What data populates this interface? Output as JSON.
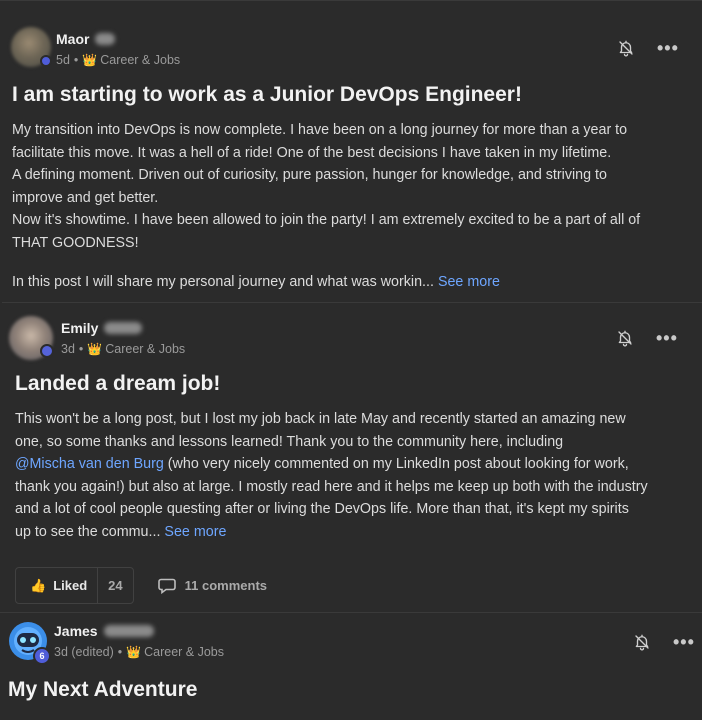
{
  "posts": [
    {
      "author": "Maor",
      "time": "5d",
      "category": "Career & Jobs",
      "title": "I am starting to work as a Junior DevOps Engineer!",
      "body_lines": [
        "My transition into DevOps is now complete. I have been on a long journey for more than a year to",
        "facilitate this move. It was a hell of a ride! One of the best decisions I have taken in my lifetime.",
        "A defining moment. Driven out of curiosity, pure passion, hunger for knowledge, and striving to",
        "improve and get better.",
        "Now it's showtime. I have been allowed to join the party! I am extremely excited to be a part of all of",
        "THAT GOODNESS!"
      ],
      "preview": "In this post I will share my personal journey and what was workin...",
      "see_more": "See more"
    },
    {
      "author": "Emily",
      "time": "3d",
      "category": "Career & Jobs",
      "title": "Landed a dream job!",
      "body_line_1": "This won't be a long post, but I lost my job back in late May and recently started an amazing new",
      "body_line_2": "one, so some thanks and lessons learned! Thank you to the community here, including",
      "mention": "@Mischa van den Burg",
      "body_line_3_rest": " (who very nicely commented on my LinkedIn post about looking for work,",
      "body_line_4": "thank you again!) but also at large. I mostly read here and it helps me keep up both with the industry",
      "body_line_5": "and a lot of cool people questing after or living the DevOps life. More than that, it's kept my spirits",
      "body_line_6": "up to see the commu...",
      "see_more": "See more",
      "liked_label": "Liked",
      "like_count": "24",
      "comments_label": "11 comments"
    },
    {
      "author": "James",
      "time": "3d (edited)",
      "category": "Career & Jobs",
      "level_badge": "6",
      "title": "My Next Adventure"
    }
  ],
  "separator": "•",
  "icons": {
    "crown": "crown-icon",
    "bell": "bell-off-icon",
    "more": "more-dots-icon",
    "like": "thumbs-up-icon",
    "comment": "comment-icon"
  },
  "colors": {
    "background": "#2b2b2b",
    "link": "#6ea6ff",
    "badge": "#4f5dd9",
    "crown": "#e6b422"
  }
}
